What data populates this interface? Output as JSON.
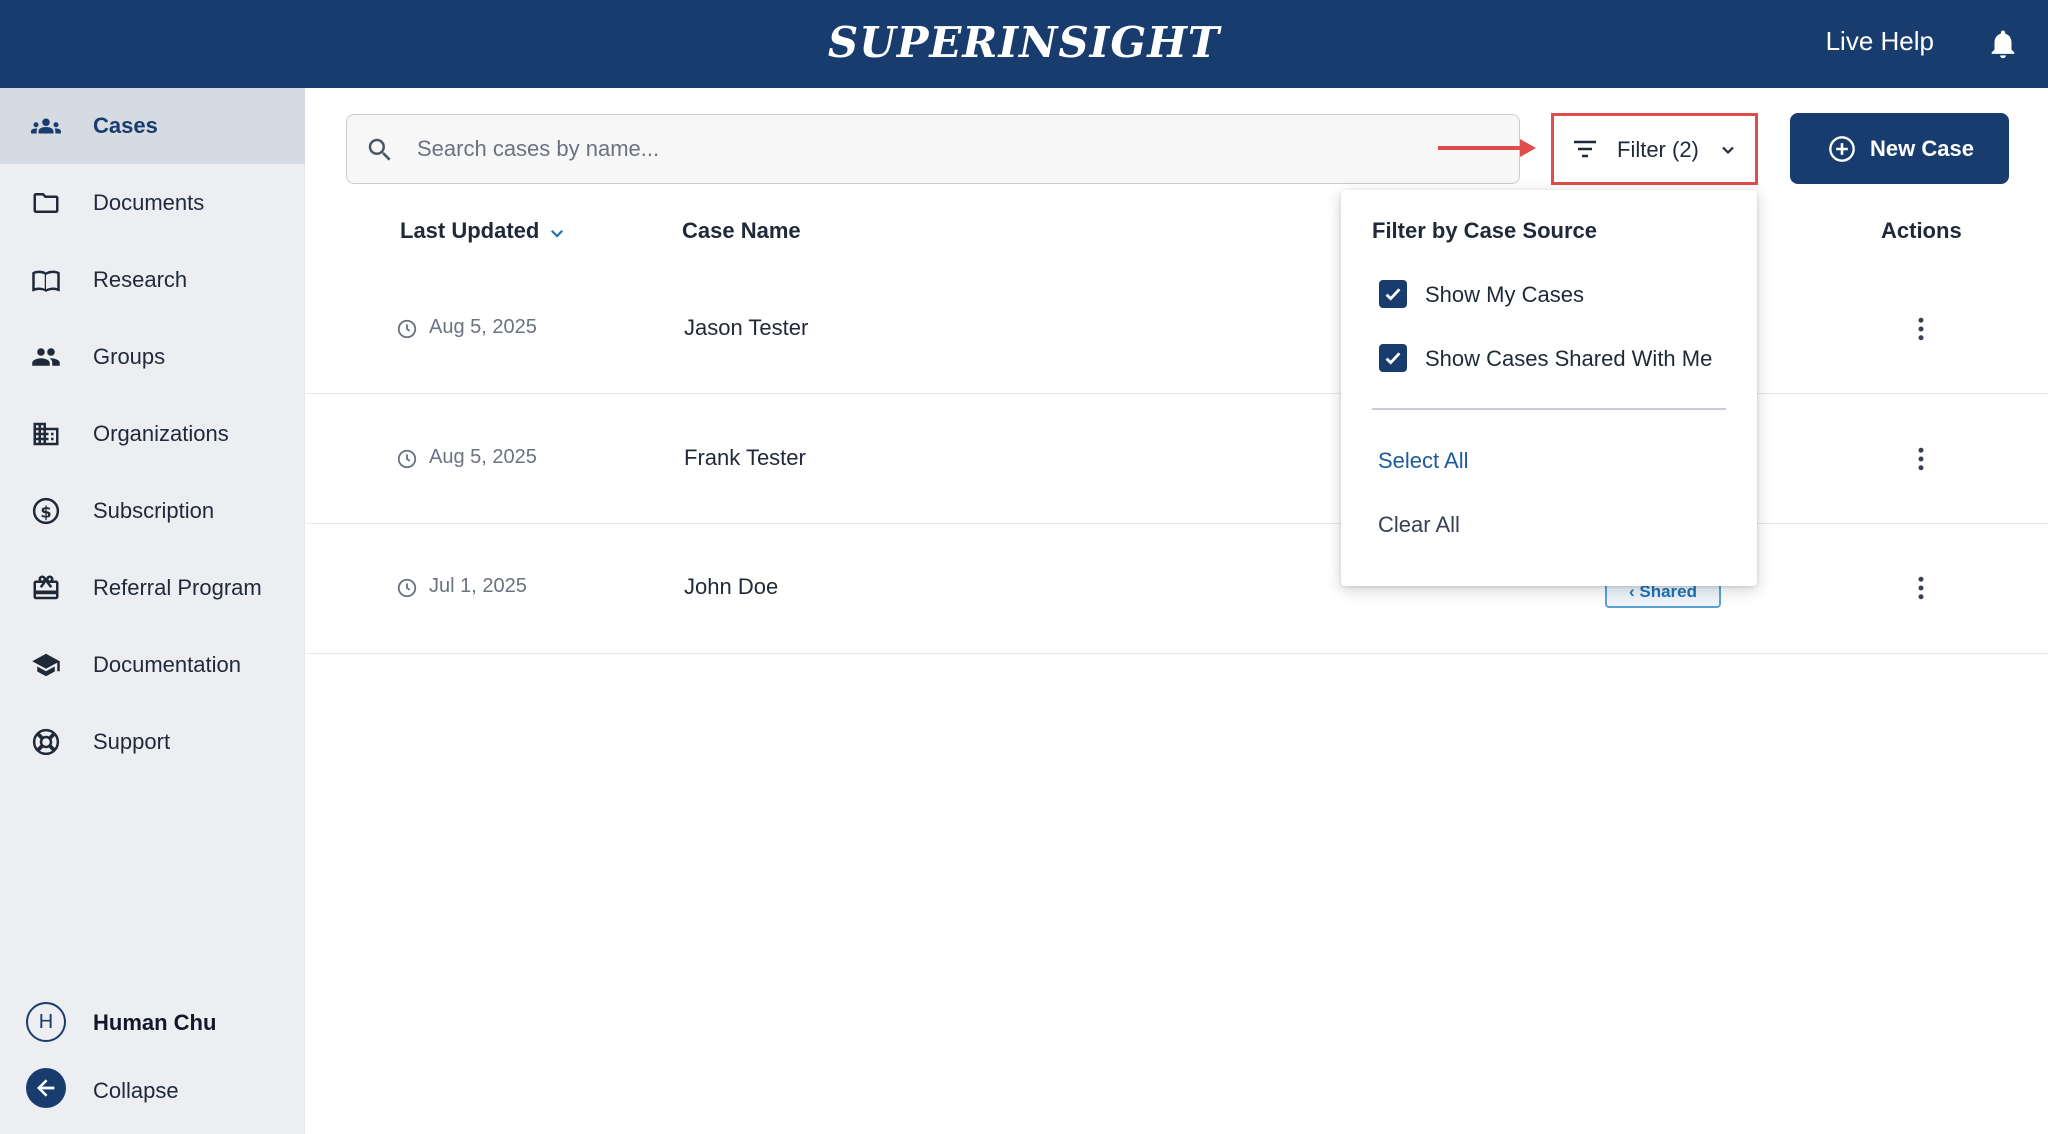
{
  "header": {
    "logo": "SUPERINSIGHT",
    "live_help": "Live Help",
    "bell_icon": "bell-icon"
  },
  "sidebar": {
    "items": [
      {
        "label": "Cases",
        "icon": "people-group-icon",
        "active": true
      },
      {
        "label": "Documents",
        "icon": "folder-icon"
      },
      {
        "label": "Research",
        "icon": "open-book-icon"
      },
      {
        "label": "Groups",
        "icon": "group-icon"
      },
      {
        "label": "Organizations",
        "icon": "building-icon"
      },
      {
        "label": "Subscription",
        "icon": "dollar-circle-icon"
      },
      {
        "label": "Referral Program",
        "icon": "gift-card-icon"
      },
      {
        "label": "Documentation",
        "icon": "graduation-cap-icon"
      },
      {
        "label": "Support",
        "icon": "lifebuoy-icon"
      }
    ],
    "user": {
      "initial": "H",
      "name": "Human Chu"
    },
    "collapse_label": "Collapse"
  },
  "search": {
    "placeholder": "Search cases by name...",
    "value": ""
  },
  "filter": {
    "label": "Filter (2)"
  },
  "new_case": {
    "label": "New Case"
  },
  "table": {
    "headers": {
      "last_updated": "Last Updated",
      "case_name": "Case Name",
      "actions": "Actions"
    },
    "rows": [
      {
        "date": "Aug 5, 2025",
        "name": "Jason Tester"
      },
      {
        "date": "Aug 5, 2025",
        "name": "Frank Tester"
      },
      {
        "date": "Jul 1, 2025",
        "name": "John Doe",
        "badge": "Shared"
      }
    ]
  },
  "dropdown": {
    "title": "Filter by Case Source",
    "options": [
      {
        "label": "Show My Cases",
        "checked": true
      },
      {
        "label": "Show Cases Shared With Me",
        "checked": true
      }
    ],
    "select_all": "Select All",
    "clear_all": "Clear All"
  },
  "colors": {
    "brand_navy": "#183c6e",
    "link_blue": "#1d5a9c",
    "highlight_red": "#e04b4b",
    "badge_blue": "#1d75b8"
  }
}
